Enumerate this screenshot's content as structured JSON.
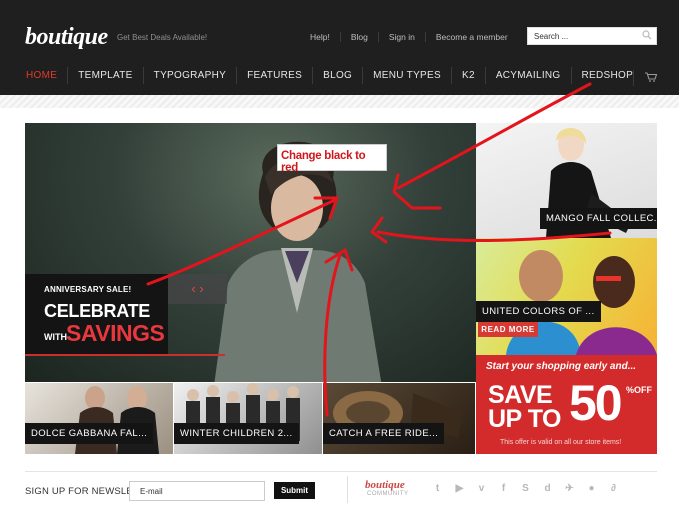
{
  "header": {
    "logo": "boutique",
    "tagline": "Get Best Deals Available!",
    "top_links": [
      "Help!",
      "Blog",
      "Sign in",
      "Become a member"
    ],
    "search_placeholder": "Search ..."
  },
  "nav": {
    "items": [
      "HOME",
      "TEMPLATE",
      "TYPOGRAPHY",
      "FEATURES",
      "BLOG",
      "MENU TYPES",
      "K2",
      "ACYMAILING",
      "REDSHOP"
    ],
    "active": "HOME"
  },
  "hero": {
    "promo_small": "ANNIVERSARY SALE!",
    "promo_big": "CELEBRATE",
    "promo_with": "WITH",
    "promo_savings": "SAVINGS",
    "slider_prev": "‹",
    "slider_next": "›"
  },
  "side": {
    "caption1": "MANGO FALL COLLEC...",
    "caption2": "UNITED COLORS OF ...",
    "read_more": "READ MORE"
  },
  "sale": {
    "top": "Start your shopping early and...",
    "save": "SAVE",
    "upto": "UP TO",
    "amount": "50",
    "percent_off": "%OFF",
    "note": "This offer is valid on all our store items!"
  },
  "thumbs": {
    "t1": "DOLCE GABBANA FAL...",
    "t2": "WINTER CHILDREN 2...",
    "t3": "CATCH A FREE RIDE..."
  },
  "annotation": {
    "text": "Change black to red"
  },
  "footer": {
    "newsletter_label": "SIGN UP FOR NEWSLETTER",
    "email_placeholder": "E-mail",
    "submit_label": "Submit",
    "community_title": "boutique",
    "community_sub": "COMMUNITY",
    "social_icons": [
      "twitter-icon",
      "youtube-icon",
      "vimeo-icon",
      "facebook-icon",
      "skype-icon",
      "digg-icon",
      "bird-icon",
      "chat-icon",
      "delicious-icon"
    ]
  },
  "colors": {
    "header_bg": "#1f1f1f",
    "accent": "#e03a2a",
    "sale_red": "#d32b2b",
    "annotation_red": "#d0171b"
  }
}
